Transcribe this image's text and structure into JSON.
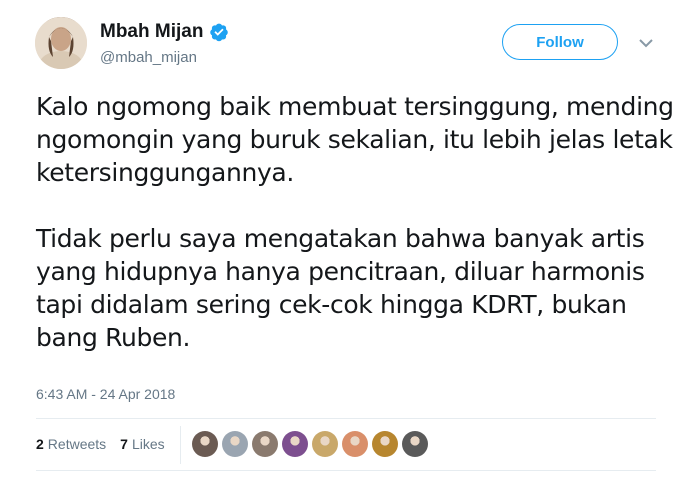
{
  "user": {
    "display_name": "Mbah Mijan",
    "handle": "@mbah_mijan",
    "verified": true
  },
  "actions": {
    "follow_label": "Follow"
  },
  "tweet": {
    "paragraphs": [
      "Kalo ngomong baik membuat tersinggung, mending ngomongin yang buruk sekalian, itu lebih jelas letak ketersinggungannya.",
      "Tidak perlu saya mengatakan bahwa banyak artis yang hidupnya hanya pencitraan, diluar harmonis tapi didalam sering cek-cok hingga KDRT, bukan bang Ruben."
    ],
    "timestamp": "6:43 AM - 24 Apr 2018"
  },
  "stats": {
    "retweets_count": "2",
    "retweets_label": "Retweets",
    "likes_count": "7",
    "likes_label": "Likes"
  },
  "colors": {
    "accent": "#1da1f2",
    "text": "#14171a",
    "muted": "#657786",
    "divider": "#e6ecf0"
  },
  "icons": {
    "verified": "verified-badge-icon",
    "more": "chevron-down-icon"
  },
  "liker_avatar_colors": [
    "#6b5b53",
    "#9aa5b1",
    "#8a7a6e",
    "#7d4f8f",
    "#c9a86a",
    "#d98f6a",
    "#b7862f",
    "#5a5a5a"
  ]
}
